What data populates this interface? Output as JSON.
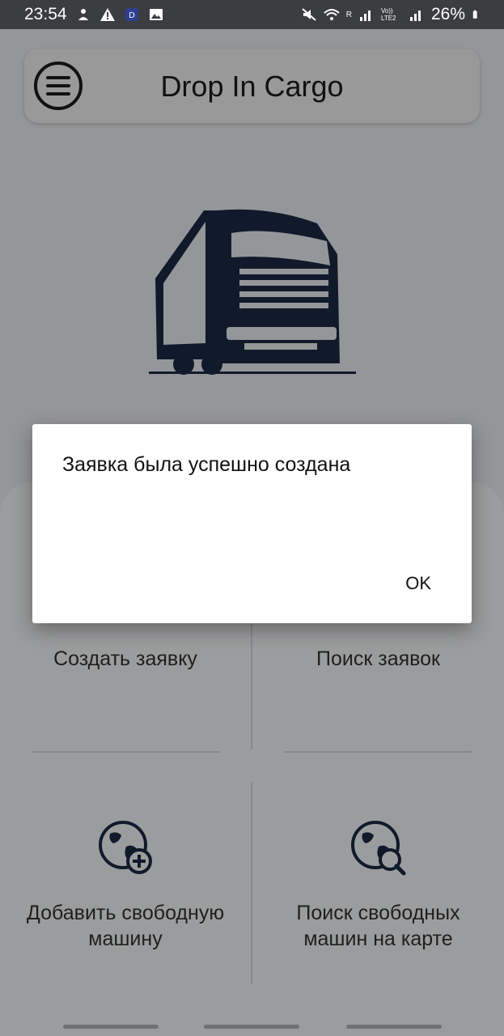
{
  "status_bar": {
    "time": "23:54",
    "network_labels": [
      "R",
      "Vo)) LTE2"
    ],
    "battery": "26%",
    "icons_left": [
      "hand-icon",
      "warning-icon",
      "app-icon",
      "image-icon"
    ],
    "icons_right": [
      "mute-icon",
      "wifi-icon",
      "signal-icon",
      "signal-icon-2",
      "battery-icon"
    ]
  },
  "app_bar": {
    "title": "Drop In Cargo",
    "menu_icon": "hamburger-icon"
  },
  "tiles": [
    {
      "label": "Создать заявку",
      "icon": ""
    },
    {
      "label": "Поиск заявок",
      "icon": ""
    },
    {
      "label": "Добавить свободную машину",
      "label_line1": "Добавить свободную",
      "label_line2": "машину",
      "icon": "globe-add-icon"
    },
    {
      "label": "Поиск свободных машин на карте",
      "label_line1": "Поиск свободных",
      "label_line2": "машин на карте",
      "icon": "globe-search-icon"
    }
  ],
  "dialog": {
    "message": "Заявка была успешно создана",
    "ok_label": "OK"
  },
  "colors": {
    "accent_navy": "#1c2b45",
    "status_bar_bg": "#3b3d40",
    "scrim": "rgba(0,0,0,0.38)"
  }
}
